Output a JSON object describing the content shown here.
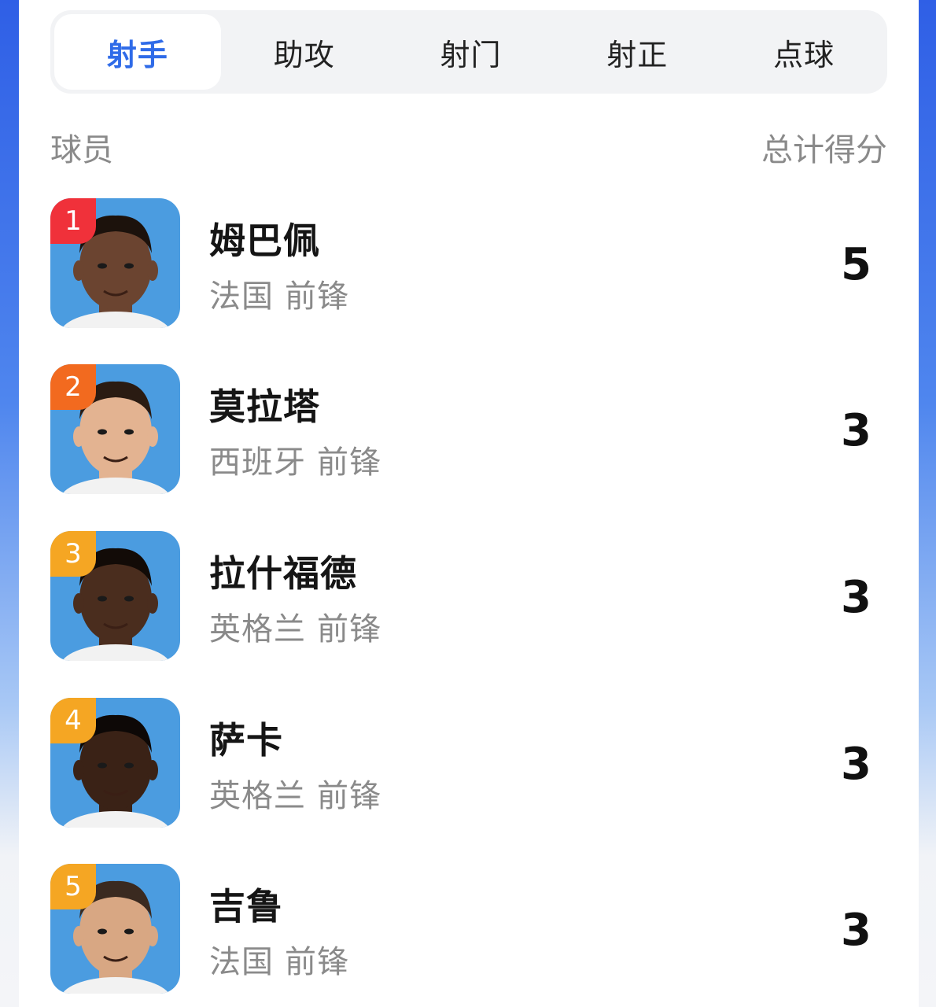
{
  "tabs": [
    {
      "label": "射手",
      "active": true
    },
    {
      "label": "助攻",
      "active": false
    },
    {
      "label": "射门",
      "active": false
    },
    {
      "label": "射正",
      "active": false
    },
    {
      "label": "点球",
      "active": false
    }
  ],
  "header": {
    "player_label": "球员",
    "total_label": "总计得分"
  },
  "colors": {
    "accent": "#2f6be8",
    "rank_1": "#f0313a",
    "rank_2": "#f26a1f",
    "rank_3_plus": "#f5a623",
    "avatar_bg": "#4b9ce0"
  },
  "players": [
    {
      "rank": "1",
      "name": "姆巴佩",
      "country": "法国",
      "position": "前锋",
      "score": "5",
      "skin": "#6b4430",
      "hair": "#1c120c"
    },
    {
      "rank": "2",
      "name": "莫拉塔",
      "country": "西班牙",
      "position": "前锋",
      "score": "3",
      "skin": "#e3b391",
      "hair": "#2a1b12"
    },
    {
      "rank": "3",
      "name": "拉什福德",
      "country": "英格兰",
      "position": "前锋",
      "score": "3",
      "skin": "#4a2d1e",
      "hair": "#120b07"
    },
    {
      "rank": "4",
      "name": "萨卡",
      "country": "英格兰",
      "position": "前锋",
      "score": "3",
      "skin": "#3a2216",
      "hair": "#0d0806"
    },
    {
      "rank": "5",
      "name": "吉鲁",
      "country": "法国",
      "position": "前锋",
      "score": "3",
      "skin": "#d8a783",
      "hair": "#3a2a20"
    }
  ]
}
